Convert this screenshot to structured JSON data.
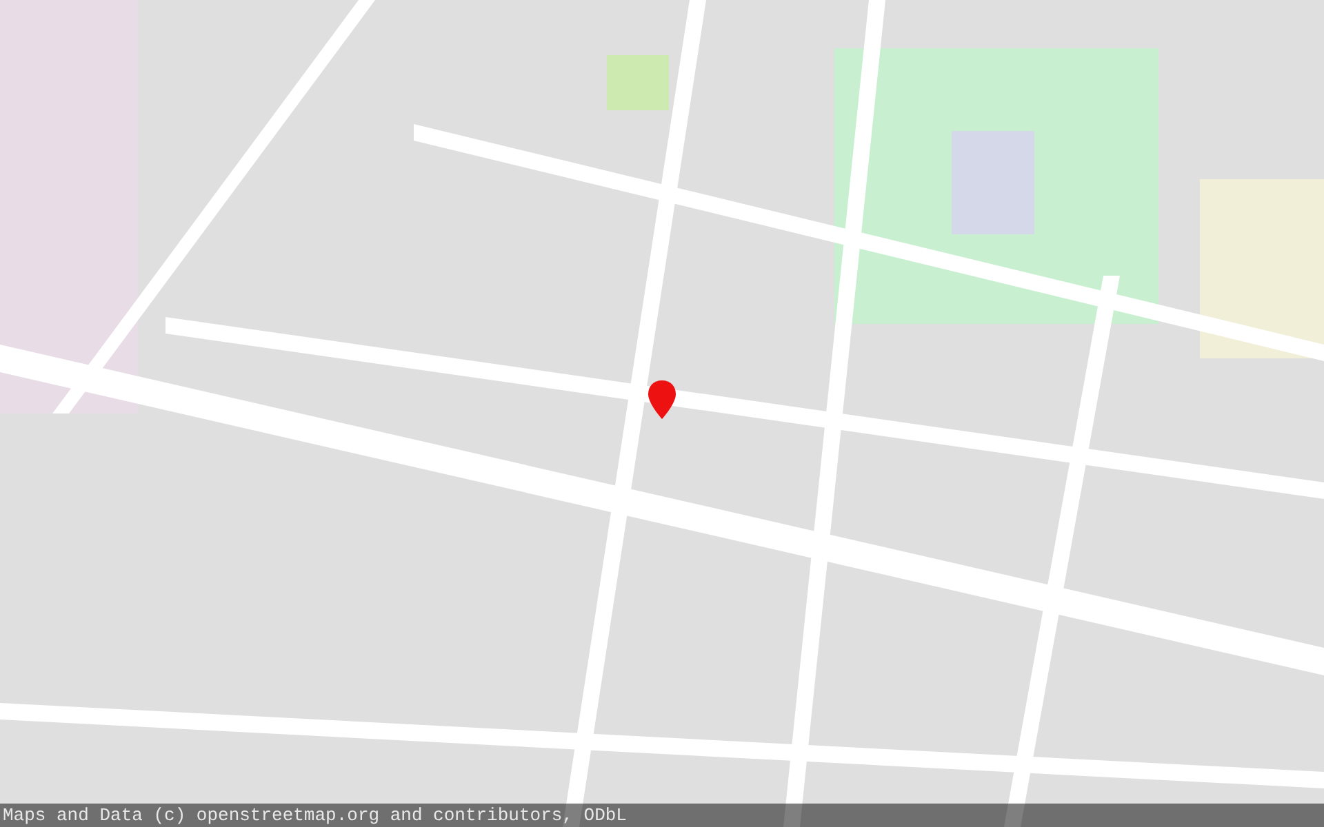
{
  "attribution": "Maps and Data (c) openstreetmap.org and contributors, ODbL"
}
